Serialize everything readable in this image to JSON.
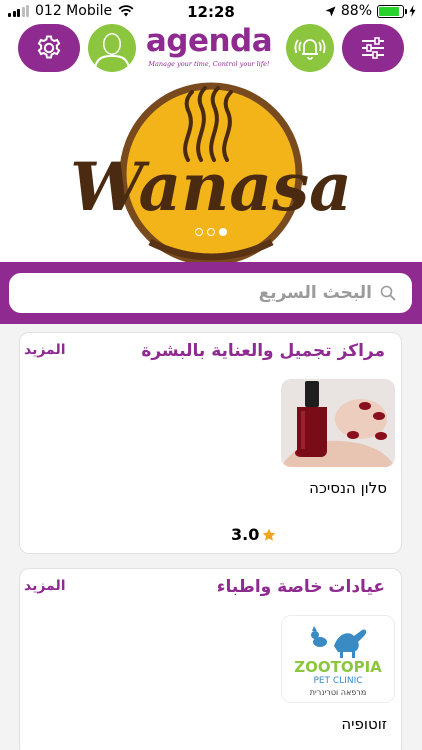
{
  "status": {
    "carrier": "012 Mobile",
    "time": "12:28",
    "battery": "88%",
    "battery_level": 0.88
  },
  "header": {
    "logo_text": "agenda",
    "logo_tagline": "Manage your time, Control your life!",
    "brand_color": "#8e2a90",
    "accent_color": "#8bc63e"
  },
  "banner": {
    "brand": "Wanasa",
    "carousel_pages": 3,
    "carousel_active": 3
  },
  "search": {
    "placeholder": "البحث السريع"
  },
  "sections": [
    {
      "title": "مراكز تجميل والعناية بالبشرة",
      "more": "المزيد",
      "items": [
        {
          "name": "סלון הנסיכה",
          "rating": "3.0",
          "image": "nail-polish-photo"
        }
      ]
    },
    {
      "title": "عيادات خاصة واطباء",
      "more": "المزيد",
      "items": [
        {
          "name": "זוטופיה",
          "image": "zootopia-logo",
          "logo_word": "ZOOTOPIA",
          "logo_sub": "PET CLINIC",
          "logo_hebrew": "מרפאה וטרינרית"
        }
      ]
    }
  ]
}
